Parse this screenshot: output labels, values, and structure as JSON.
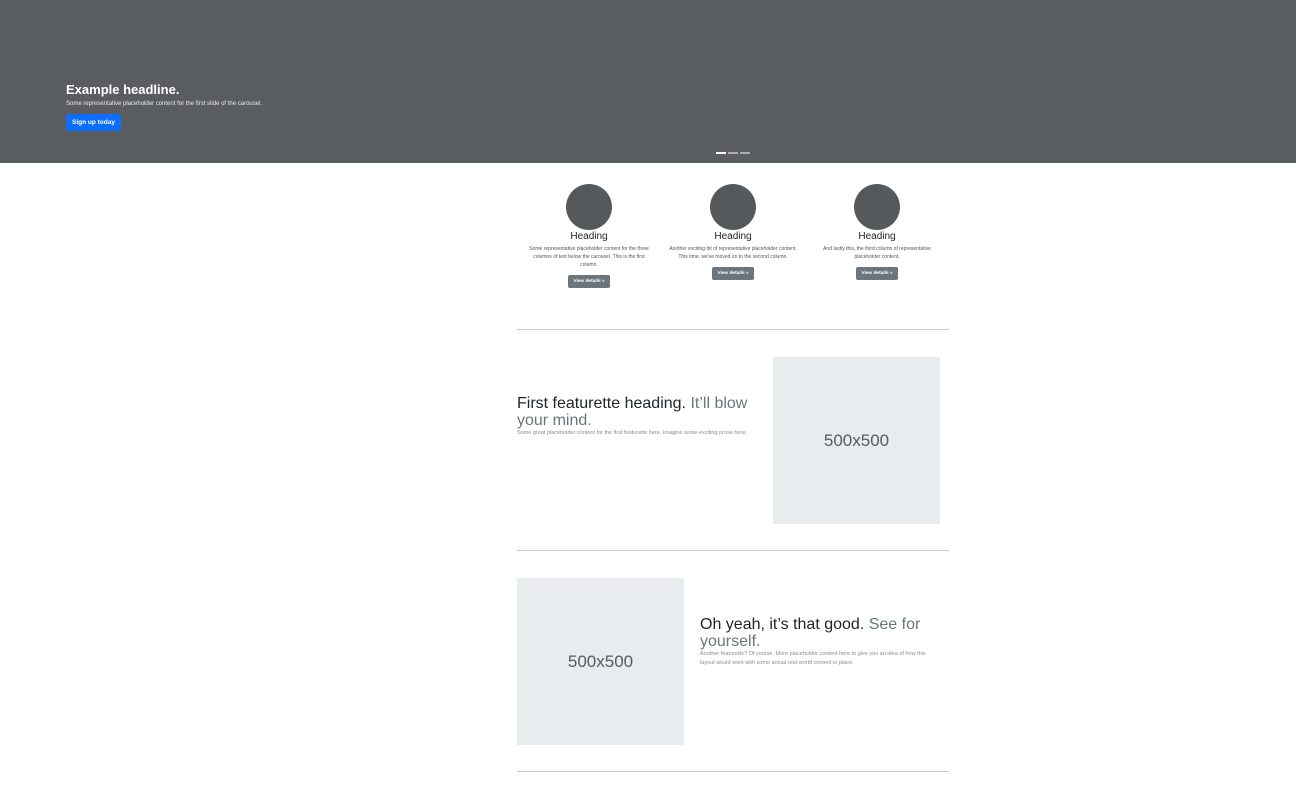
{
  "carousel": {
    "headline": "Example headline.",
    "text": "Some representative placeholder content for the first slide of the carousel.",
    "button": "Sign up today",
    "slides_count": 3,
    "active_slide": 1
  },
  "columns": [
    {
      "heading": "Heading",
      "text": "Some representative placeholder content for the three columns of text below the carousel. This is the first column.",
      "button": "View details »"
    },
    {
      "heading": "Heading",
      "text": "Another exciting bit of representative placeholder content. This time, we've moved on to the second column.",
      "button": "View details »"
    },
    {
      "heading": "Heading",
      "text": "And lastly this, the third column of representative placeholder content.",
      "button": "View details »"
    }
  ],
  "featurettes": [
    {
      "heading": "First featurette heading.",
      "muted": "It’ll blow your mind.",
      "text": "Some great placeholder content for the first featurette here. Imagine some exciting prose here.",
      "image_label": "500x500"
    },
    {
      "heading": "Oh yeah, it’s that good.",
      "muted": "See for yourself.",
      "text": "Another featurette? Of course. More placeholder content here to give you an idea of how this layout would work with some actual real-world content in place.",
      "image_label": "500x500"
    }
  ],
  "colors": {
    "carousel_bg": "#5a5d60",
    "primary": "#0d6efd",
    "secondary": "#6c757d",
    "placeholder_bg": "#e9ecef"
  }
}
